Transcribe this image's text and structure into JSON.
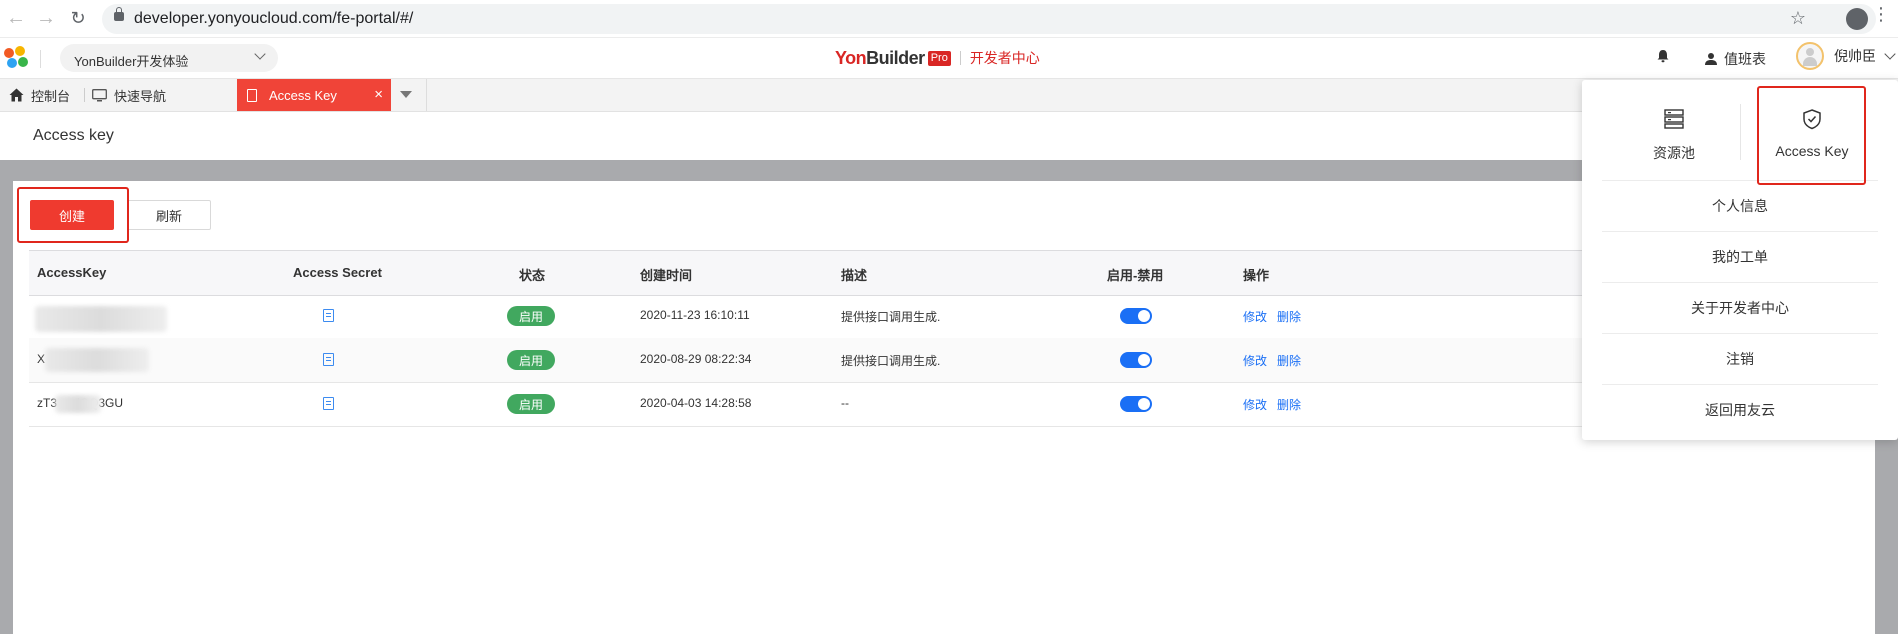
{
  "browser": {
    "url": "developer.yonyoucloud.com/fe-portal/#/"
  },
  "header": {
    "env_selector": "YonBuilder开发体验",
    "brand_name_red": "Yon",
    "brand_name_dark": "Builder",
    "brand_badge": "Pro",
    "brand_subtitle": "开发者中心",
    "duty_table": "值班表",
    "user_name": "倪帅臣"
  },
  "tabs": {
    "console": "控制台",
    "quick_nav": "快速导航",
    "active_tab": "Access Key",
    "close_glyph": "×"
  },
  "page": {
    "title": "Access key",
    "create_button": "创建",
    "refresh_button": "刷新"
  },
  "table": {
    "headers": {
      "access_key": "AccessKey",
      "access_secret": "Access Secret",
      "status": "状态",
      "created_time": "创建时间",
      "description": "描述",
      "enable_disable": "启用-禁用",
      "operations": "操作"
    },
    "rows": [
      {
        "access_key": "",
        "status": "启用",
        "created_time": "2020-11-23 16:10:11",
        "description": "提供接口调用生成.",
        "edit": "修改",
        "delete": "删除"
      },
      {
        "access_key": "X",
        "status": "启用",
        "created_time": "2020-08-29 08:22:34",
        "description": "提供接口调用生成.",
        "edit": "修改",
        "delete": "删除"
      },
      {
        "access_key": "zT3      iOQ3GU",
        "status": "启用",
        "created_time": "2020-04-03 14:28:58",
        "description": "--",
        "edit": "修改",
        "delete": "删除"
      }
    ]
  },
  "dropdown": {
    "resource_pool": "资源池",
    "access_key": "Access Key",
    "items": [
      "个人信息",
      "我的工单",
      "关于开发者中心",
      "注销",
      "返回用友云"
    ]
  },
  "colors": {
    "brand_red": "#d92624",
    "accent_red": "#ef3a2f",
    "link_blue": "#1a6ff5",
    "status_green": "#41a85f"
  }
}
